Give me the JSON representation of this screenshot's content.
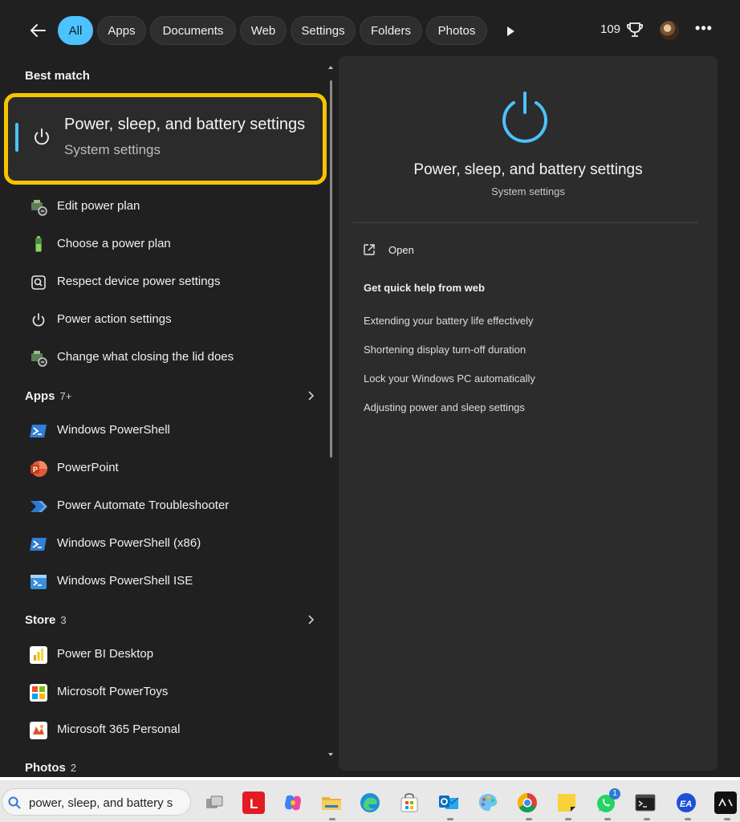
{
  "filters": {
    "tabs": [
      {
        "label": "All",
        "active": true
      },
      {
        "label": "Apps"
      },
      {
        "label": "Documents"
      },
      {
        "label": "Web"
      },
      {
        "label": "Settings"
      },
      {
        "label": "Folders"
      },
      {
        "label": "Photos"
      }
    ],
    "points": "109",
    "overflow_label": "•••"
  },
  "best_match": {
    "heading": "Best match",
    "title": "Power, sleep, and battery settings",
    "subtitle": "System settings",
    "icon": "power-icon"
  },
  "settings_results": [
    {
      "label": "Edit power plan",
      "icon": "power-plan-icon"
    },
    {
      "label": "Choose a power plan",
      "icon": "battery-icon"
    },
    {
      "label": "Respect device power settings",
      "icon": "device-search-icon"
    },
    {
      "label": "Power action settings",
      "icon": "power-icon"
    },
    {
      "label": "Change what closing the lid does",
      "icon": "power-plan-icon"
    }
  ],
  "apps": {
    "heading": "Apps",
    "count": "7+",
    "items": [
      {
        "label": "Windows PowerShell",
        "icon": "powershell-icon"
      },
      {
        "label": "PowerPoint",
        "icon": "powerpoint-icon"
      },
      {
        "label": "Power Automate Troubleshooter",
        "icon": "power-automate-icon"
      },
      {
        "label": "Windows PowerShell (x86)",
        "icon": "powershell-icon"
      },
      {
        "label": "Windows PowerShell ISE",
        "icon": "powershell-ise-icon"
      }
    ]
  },
  "store": {
    "heading": "Store",
    "count": "3",
    "items": [
      {
        "label": "Power BI Desktop",
        "icon": "power-bi-icon"
      },
      {
        "label": "Microsoft PowerToys",
        "icon": "powertoys-icon"
      },
      {
        "label": "Microsoft 365 Personal",
        "icon": "m365-icon"
      }
    ]
  },
  "photos": {
    "heading": "Photos",
    "count": "2"
  },
  "preview": {
    "title": "Power, sleep, and battery settings",
    "subtitle": "System settings",
    "open_label": "Open",
    "help_heading": "Get quick help from web",
    "links": [
      "Extending your battery life effectively",
      "Shortening display turn-off duration",
      "Lock your Windows PC automatically",
      "Adjusting power and sleep settings"
    ]
  },
  "taskbar": {
    "search_text": "power, sleep, and battery s",
    "whatsapp_badge": "1",
    "icons": [
      "task-view-icon",
      "l-app-icon",
      "copilot-icon",
      "file-explorer-icon",
      "edge-icon",
      "store-icon",
      "outlook-icon",
      "paint-icon",
      "chrome-icon",
      "sticky-notes-icon",
      "whatsapp-icon",
      "terminal-icon",
      "ea-icon",
      "acer-icon"
    ]
  },
  "colors": {
    "accent": "#4cc2ff",
    "highlight_border": "#f6c400",
    "panel": "#202020",
    "preview": "#2c2c2c"
  }
}
